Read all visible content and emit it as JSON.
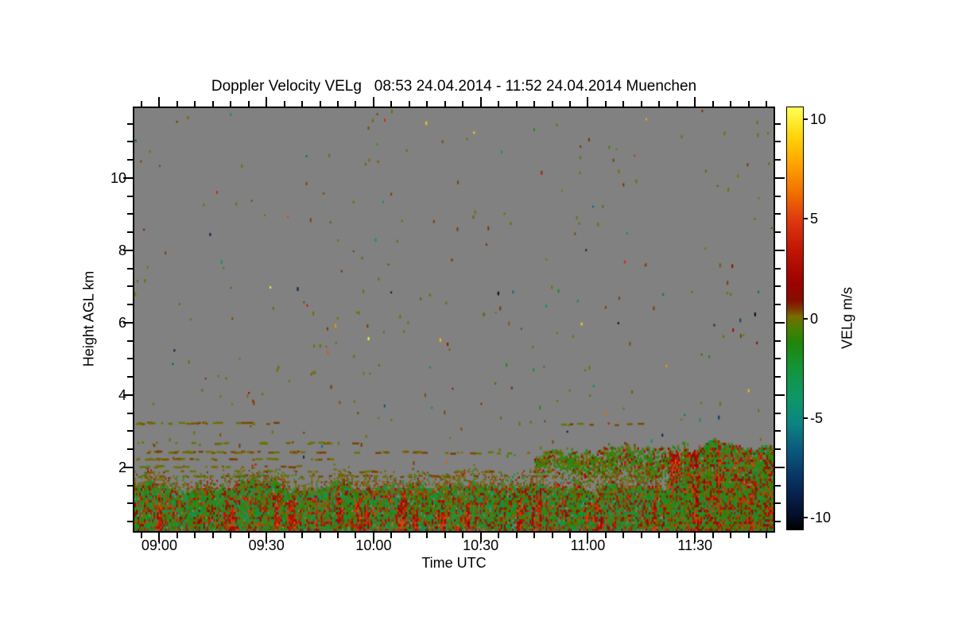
{
  "chart_data": {
    "type": "heatmap",
    "title": "Doppler Velocity VELg   08:53 24.04.2014 - 11:52 24.04.2014 Muenchen",
    "instrument_product": "Doppler Velocity VELg",
    "site": "Muenchen",
    "time_start_utc": "08:53 24.04.2014",
    "time_end_utc": "11:52 24.04.2014",
    "xlabel": "Time UTC",
    "ylabel": "Height AGL km",
    "x_span_minutes": 179,
    "x_tick_minutes": [
      7,
      37,
      67,
      97,
      127,
      157
    ],
    "x_tick_labels": [
      "09:00",
      "09:30",
      "10:00",
      "10:30",
      "11:00",
      "11:30"
    ],
    "x_minor_step_minutes": 5,
    "x_minor_offset_minutes": 2,
    "y_range_km": [
      0.24,
      11.93
    ],
    "y_tick_values_km": [
      2,
      4,
      6,
      8,
      10
    ],
    "y_tick_labels": [
      "2",
      "4",
      "6",
      "8",
      "10"
    ],
    "y_minor_step_km": 0.5,
    "grid": false,
    "no_data_color": "#818181",
    "colorbar": {
      "label": "VELg m/s",
      "tick_values": [
        10,
        5,
        0,
        -5,
        -10
      ],
      "tick_labels": [
        "10",
        "5",
        "0",
        "-5",
        "-10"
      ],
      "value_range": [
        -10.6,
        10.6
      ],
      "palette_stops": [
        [
          10.6,
          "#ffff55"
        ],
        [
          9.2,
          "#ffd60a"
        ],
        [
          7.8,
          "#ffa500"
        ],
        [
          6.3,
          "#f07000"
        ],
        [
          5.0,
          "#e03a10"
        ],
        [
          3.4,
          "#c01505"
        ],
        [
          1.8,
          "#9c0300"
        ],
        [
          0.9,
          "#870e00"
        ],
        [
          0.45,
          "#7c3b00"
        ],
        [
          0.1,
          "#7c6c00"
        ],
        [
          -0.4,
          "#4f7d02"
        ],
        [
          -1.2,
          "#218609"
        ],
        [
          -2.6,
          "#12953c"
        ],
        [
          -4.0,
          "#0e9768"
        ],
        [
          -5.3,
          "#0c8481"
        ],
        [
          -6.6,
          "#0a5a7d"
        ],
        [
          -7.8,
          "#093a68"
        ],
        [
          -9.0,
          "#06204a"
        ],
        [
          -10.0,
          "#030d26"
        ],
        [
          -10.6,
          "#000000"
        ]
      ]
    },
    "features": {
      "speckles": {
        "count": 300,
        "time_min": [
          0,
          179
        ],
        "height_km": [
          1.9,
          11.9
        ],
        "velocity_near_zero_fraction": 0.72,
        "velocity_near_zero_range": [
          -0.4,
          0.6
        ],
        "velocity_full_range": [
          -10.6,
          10.6
        ]
      },
      "streak_velocity_range": [
        -0.2,
        0.5
      ],
      "aerosol_layer_streaks": [
        {
          "height_km": 3.2,
          "time_min": [
            0,
            40
          ],
          "density": 0.5
        },
        {
          "height_km": 3.17,
          "time_min": [
            116,
            142
          ],
          "density": 0.4
        },
        {
          "height_km": 2.65,
          "time_min": [
            0,
            62
          ],
          "density": 0.3
        },
        {
          "height_km": 2.4,
          "time_min": [
            0,
            82
          ],
          "density": 0.55
        },
        {
          "height_km": 2.38,
          "time_min": [
            82,
            140
          ],
          "density": 0.3
        },
        {
          "height_km": 2.2,
          "time_min": [
            0,
            56
          ],
          "density": 0.4
        },
        {
          "height_km": 2.0,
          "time_min": [
            0,
            46
          ],
          "density": 0.28
        },
        {
          "height_km": 1.86,
          "time_min": [
            0,
            179
          ],
          "density": 0.22
        },
        {
          "height_km": 1.73,
          "time_min": [
            0,
            179
          ],
          "density": 0.4
        }
      ],
      "boundary_layer": {
        "time_min": [
          0,
          179
        ],
        "height_base_km": 0.24,
        "height_top_mean_km": 1.42,
        "height_top_jitter_km": 0.28,
        "fringe_depth_km": 0.5,
        "gap_fraction": 0.03,
        "fraction_green": 0.46,
        "green_velocity_range": [
          -3.3,
          -0.5
        ],
        "fraction_near_zero": 0.29,
        "near_zero_velocity_range": [
          -0.45,
          0.7
        ],
        "fraction_red": 0.2,
        "red_velocity_range": [
          0.9,
          5.1
        ],
        "fraction_teal": 0.05,
        "teal_velocity_range": [
          -5.6,
          -3.4
        ]
      },
      "updraft_plumes": {
        "count": 26,
        "width_minutes": [
          0.6,
          1.8
        ],
        "top_height_km": [
          0.8,
          1.55
        ],
        "velocity_range": [
          1.2,
          5.5
        ],
        "fill_probability": 0.7
      },
      "cloud_band": {
        "time_min": [
          112,
          155
        ],
        "center_height_km": 2.08,
        "half_depth_km": [
          0.12,
          0.4
        ],
        "fill_probability": 0.82,
        "fraction_green": 0.62,
        "green_velocity_range": [
          -1.7,
          -0.1
        ],
        "fraction_near_zero": 0.28,
        "near_zero_velocity_range": [
          -0.1,
          0.6
        ],
        "red_fraction_early": 0.1,
        "red_fraction_late": 0.3,
        "red_fraction_after_min": 145,
        "red_velocity_range": [
          1.0,
          3.6
        ]
      },
      "strong_updraft_column": {
        "time_min": [
          150,
          152.6
        ],
        "height_km": [
          0.25,
          2.3
        ],
        "velocity_range": [
          1.5,
          5.5
        ],
        "fill_probability": 0.78
      },
      "right_mass": {
        "time_min": [
          154,
          179
        ],
        "base_km": 0.24,
        "top_profile_min_km": [
          [
            154,
            2.3
          ],
          [
            158,
            2.52
          ],
          [
            162,
            2.8
          ],
          [
            166,
            2.62
          ],
          [
            170,
            2.5
          ],
          [
            174,
            2.42
          ],
          [
            177,
            2.58
          ],
          [
            179,
            2.48
          ]
        ],
        "gap_fraction": 0.04,
        "fraction_green": 0.5,
        "green_velocity_range": [
          -2.6,
          -0.3
        ],
        "fraction_near_zero": 0.2,
        "near_zero_velocity_range": [
          -0.3,
          0.8
        ],
        "fraction_red": 0.26,
        "red_velocity_range": [
          0.8,
          5.2
        ],
        "fraction_teal": 0.04,
        "teal_velocity_range": [
          -5.2,
          -3.0
        ],
        "red_column_times_min": [
          157,
          163.5,
          172.5
        ],
        "red_column_half_width_min": 0.8
      }
    }
  }
}
